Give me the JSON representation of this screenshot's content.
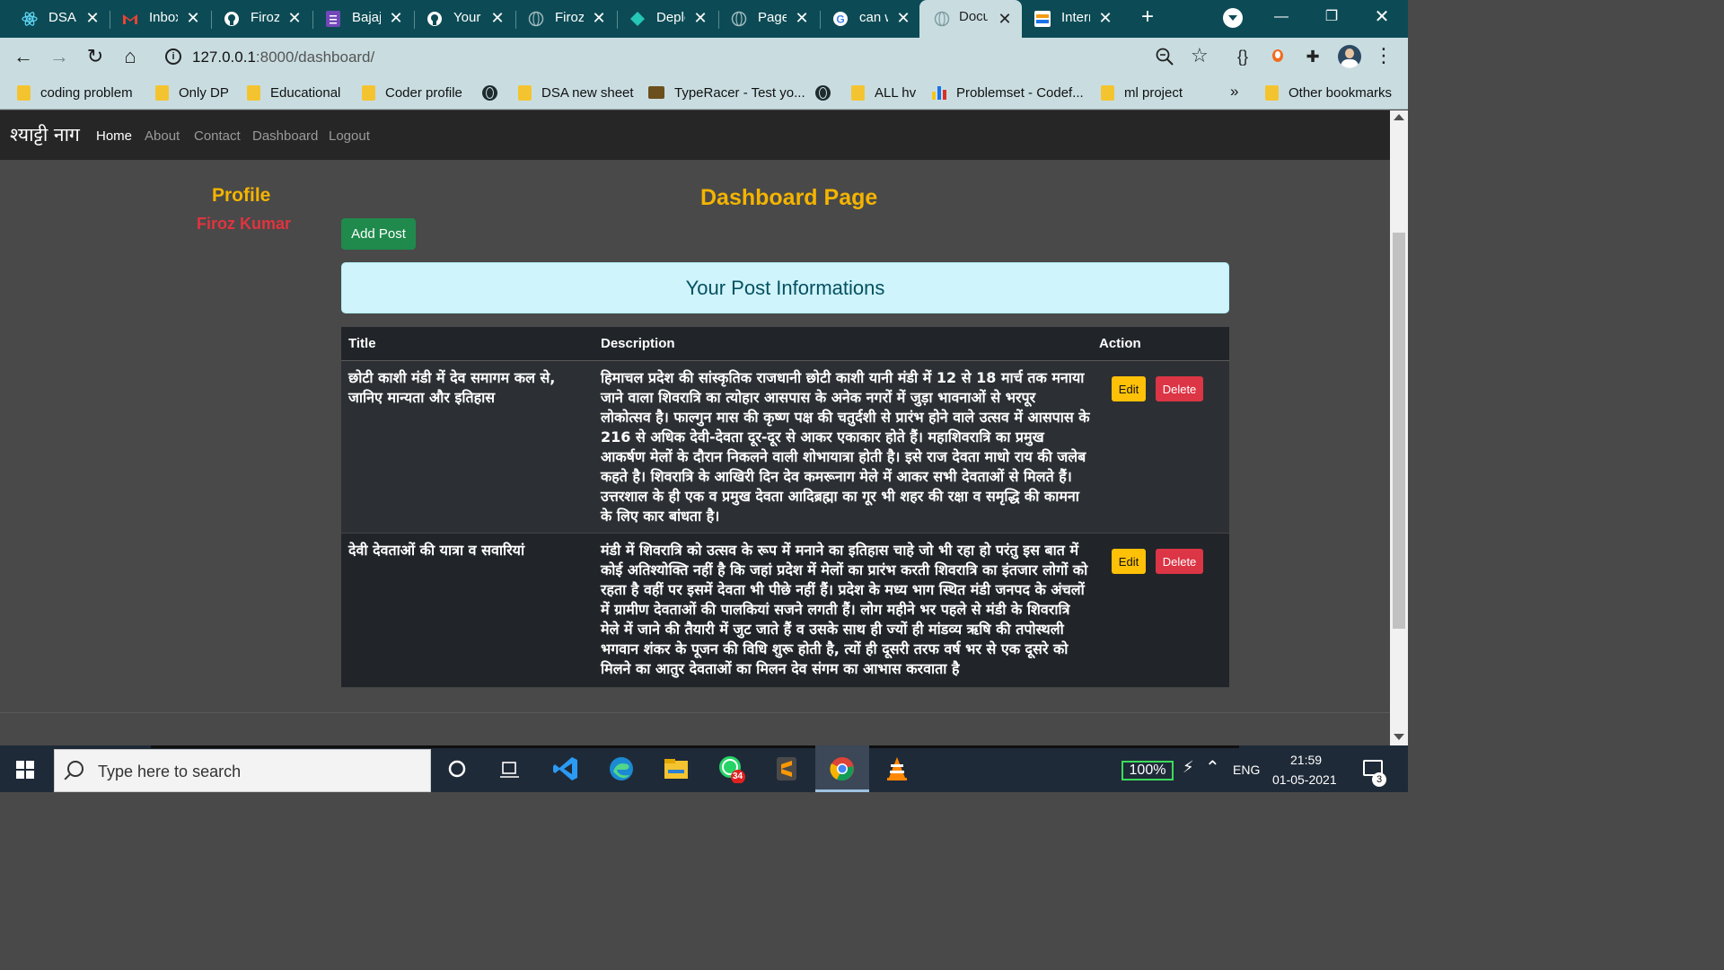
{
  "browser": {
    "tabs": [
      {
        "label": "DSA l",
        "icon": "react-icon"
      },
      {
        "label": "Inbox",
        "icon": "gmail-icon"
      },
      {
        "label": "Firoz",
        "icon": "github-icon"
      },
      {
        "label": "Bajaj",
        "icon": "forms-icon"
      },
      {
        "label": "Your",
        "icon": "github-icon"
      },
      {
        "label": "Firoz",
        "icon": "globe-icon"
      },
      {
        "label": "Deplo",
        "icon": "netlify-icon"
      },
      {
        "label": "Page",
        "icon": "globe-icon"
      },
      {
        "label": "can w",
        "icon": "google-icon"
      },
      {
        "label": "Docu",
        "icon": "globe-icon"
      },
      {
        "label": "Intern",
        "icon": "internshala-icon"
      }
    ],
    "active_tab_index": 9,
    "url_host": "127.0.0.1",
    "url_rest": ":8000/dashboard/",
    "bookmarks": [
      {
        "label": "coding problem",
        "icon": "folder-icon"
      },
      {
        "label": "Only DP",
        "icon": "folder-icon"
      },
      {
        "label": "Educational",
        "icon": "folder-icon"
      },
      {
        "label": "Coder profile",
        "icon": "folder-icon"
      },
      {
        "label": "",
        "icon": "globe-icon"
      },
      {
        "label": "DSA new sheet",
        "icon": "folder-icon"
      },
      {
        "label": "TypeRacer - Test yo...",
        "icon": "typeracer-icon"
      },
      {
        "label": "",
        "icon": "globe-icon"
      },
      {
        "label": "ALL hv",
        "icon": "folder-icon"
      },
      {
        "label": "Problemset - Codef...",
        "icon": "codeforces-icon"
      },
      {
        "label": "ml project",
        "icon": "folder-icon"
      }
    ],
    "bookmarks_more": "»",
    "other_bookmarks": "Other bookmarks"
  },
  "site": {
    "brand": "श्याट्टी नाग",
    "nav": [
      "Home",
      "About",
      "Contact",
      "Dashboard",
      "Logout"
    ],
    "active_nav": "Home"
  },
  "dashboard": {
    "profile_heading": "Profile",
    "profile_name": "Firoz Kumar",
    "page_title": "Dashboard Page",
    "add_post_label": "Add Post",
    "alert_text": "Your Post Informations",
    "table": {
      "headers": {
        "title": "Title",
        "description": "Description",
        "action": "Action"
      },
      "rows": [
        {
          "title": "छोटी काशी मंडी में देव समागम कल से, जानिए मान्यता और इतिहास",
          "description": "हिमाचल प्रदेश की सांस्कृतिक राजधानी छोटी काशी यानी मंडी में 12 से 18 मार्च तक मनाया जाने वाला शिवरात्रि का त्योहार आसपास के अनेक नगरों में जुड़ा भावनाओं से भरपूर लोकोत्सव है। फाल्गुन मास की कृष्ण पक्ष की चतुर्दशी से प्रारंभ होने वाले उत्सव में आसपास के 216 से अधिक देवी-देवता दूर-दूर से आकर एकाकार होते हैं। महाशिवरात्रि का प्रमुख आकर्षण मेलों के दौरान निकलने वाली शोभायात्रा होती है। इसे राज देवता माधो राय की जलेब कहते है। शिवरात्रि के आखिरी दिन देव कमरूनाग मेले में आकर सभी देवताओं से मिलते हैं। उत्तरशाल के ही एक व प्रमुख देवता आदिब्रह्मा का गूर भी शहर की रक्षा व समृद्धि की कामना के लिए कार बांधता है।",
          "edit": "Edit",
          "delete": "Delete"
        },
        {
          "title": "देवी देवताओं की यात्रा व सवारियां",
          "description": "मंडी में शिवरात्रि को उत्सव के रूप में मनाने का इतिहास चाहे जो भी रहा हो परंतु इस बात में कोई अतिश्योक्ति नहीं है कि जहां प्रदेश में मेलों का प्रारंभ करती शिवरात्रि का इंतजार लोगों को रहता है वहीं पर इसमें देवता भी पीछे नहीं हैं। प्रदेश के मध्य भाग स्थित मंडी जनपद के अंचलों में ग्रामीण देवताओं की पालकियां सजने लगती हैं। लोग महीने भर पहले से मंडी के शिवरात्रि मेले में जाने की तैयारी में जुट जाते हैं व उसके साथ ही ज्यों ही मांडव्य ऋषि की तपोस्थली भगवान शंकर के पूजन की विधि शुरू होती है, त्यों ही दूसरी तरफ वर्ष भर से एक दूसरे को मिलने का आतुर देवताओं का मिलन देव संगम का आभास करवाता है",
          "edit": "Edit",
          "delete": "Delete"
        }
      ]
    }
  },
  "taskbar": {
    "search_placeholder": "Type here to search",
    "battery": "100%",
    "language": "ENG",
    "time": "21:59",
    "date": "01-05-2021",
    "whatsapp_badge": "34",
    "notification_count": "3"
  },
  "colors": {
    "tabstrip": "#0c4b55",
    "toolbar": "#c9dde1",
    "page_bg": "#494949",
    "navbar": "#262626",
    "accent_yellow": "#f4b400",
    "profile_red": "#e0343f",
    "success": "#1f8a4c",
    "alert_bg": "#cff4fc",
    "table_dark": "#212529"
  }
}
